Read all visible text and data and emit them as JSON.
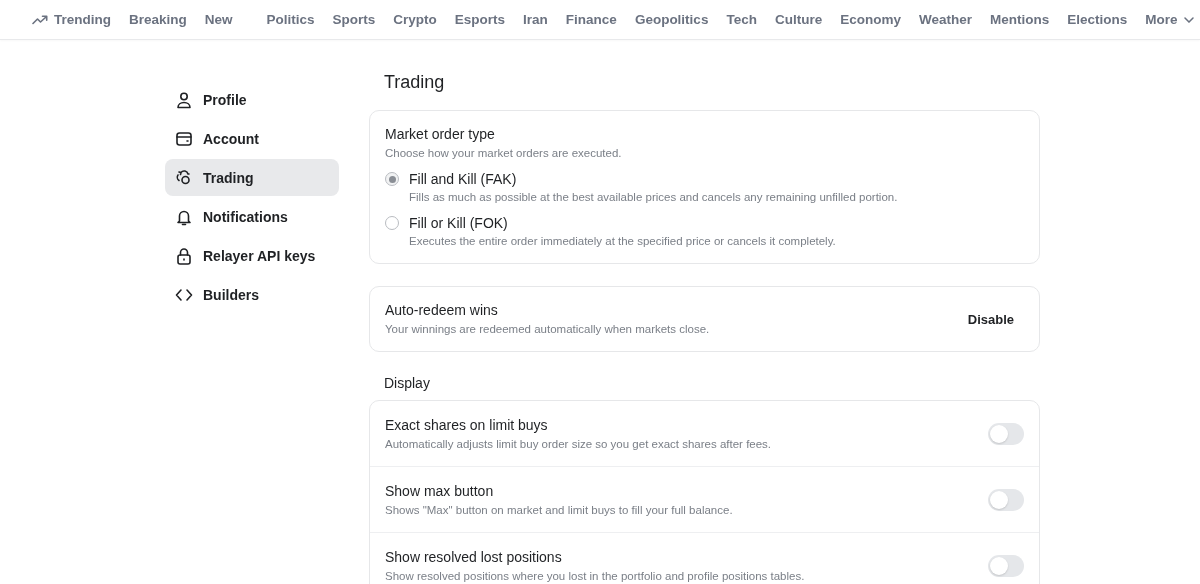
{
  "nav": {
    "primary": [
      {
        "label": "Trending",
        "kind": "trending"
      },
      {
        "label": "Breaking",
        "kind": "link"
      },
      {
        "label": "New",
        "kind": "link"
      }
    ],
    "categories": [
      "Politics",
      "Sports",
      "Crypto",
      "Esports",
      "Iran",
      "Finance",
      "Geopolitics",
      "Tech",
      "Culture",
      "Economy",
      "Weather",
      "Mentions",
      "Elections"
    ],
    "more": "More"
  },
  "sidebar": {
    "items": [
      {
        "label": "Profile",
        "selected": false
      },
      {
        "label": "Account",
        "selected": false
      },
      {
        "label": "Trading",
        "selected": true
      },
      {
        "label": "Notifications",
        "selected": false
      },
      {
        "label": "Relayer API keys",
        "selected": false
      },
      {
        "label": "Builders",
        "selected": false
      }
    ]
  },
  "page_title": "Trading",
  "market_order": {
    "title": "Market order type",
    "description": "Choose how your market orders are executed.",
    "options": [
      {
        "label": "Fill and Kill (FAK)",
        "description": "Fills as much as possible at the best available prices and cancels any remaining unfilled portion.",
        "selected": true
      },
      {
        "label": "Fill or Kill (FOK)",
        "description": "Executes the entire order immediately at the specified price or cancels it completely.",
        "selected": false
      }
    ]
  },
  "auto_redeem": {
    "title": "Auto-redeem wins",
    "description": "Your winnings are redeemed automatically when markets close.",
    "button": "Disable"
  },
  "display": {
    "heading": "Display",
    "settings": [
      {
        "title": "Exact shares on limit buys",
        "description": "Automatically adjusts limit buy order size so you get exact shares after fees.",
        "on": false
      },
      {
        "title": "Show max button",
        "description": "Shows \"Max\" button on market and limit buys to fill your full balance.",
        "on": false
      },
      {
        "title": "Show resolved lost positions",
        "description": "Show resolved positions where you lost in the portfolio and profile positions tables.",
        "on": false
      }
    ]
  }
}
